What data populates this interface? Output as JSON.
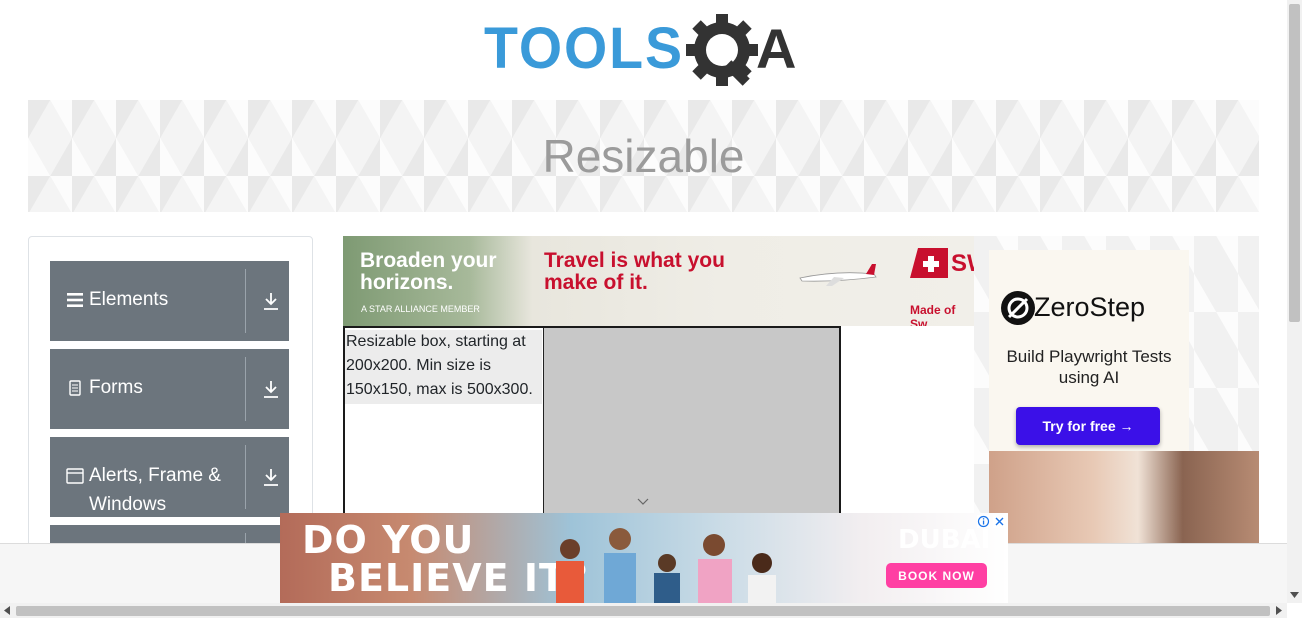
{
  "header": {
    "logo_alt": "TOOLSQA"
  },
  "banner": {
    "title": "Resizable"
  },
  "sidebar": {
    "groups": [
      {
        "label": "Elements",
        "icon": "hamburger-icon"
      },
      {
        "label": "Forms",
        "icon": "document-icon"
      },
      {
        "label": "Alerts, Frame & Windows",
        "icon": "window-icon"
      }
    ]
  },
  "ad_top": {
    "left_text": "Broaden your horizons.",
    "member_text": "A STAR ALLIANCE MEMBER",
    "main_text": "Travel is what you make of it.",
    "brand_partial": "SW",
    "tagline_partial": "Made of Sw"
  },
  "resizable": {
    "text": "Resizable box, starting at 200x200. Min size is 150x150, max is 500x300."
  },
  "ad_right": {
    "brand": "ZeroStep",
    "tagline": "Build Playwright Tests using AI",
    "button": "Try for free →"
  },
  "ad_bottom": {
    "headline_1": "DO YOU",
    "headline_2": "BELIEVE IT?",
    "brand": "DUBAI",
    "button": "BOOK NOW"
  },
  "colors": {
    "sidebar_group_bg": "#6c757d",
    "logo_blue": "#3a9ad9",
    "logo_dark": "#333333",
    "zerostep_button": "#3b10e8",
    "swiss_red": "#c8102e"
  }
}
